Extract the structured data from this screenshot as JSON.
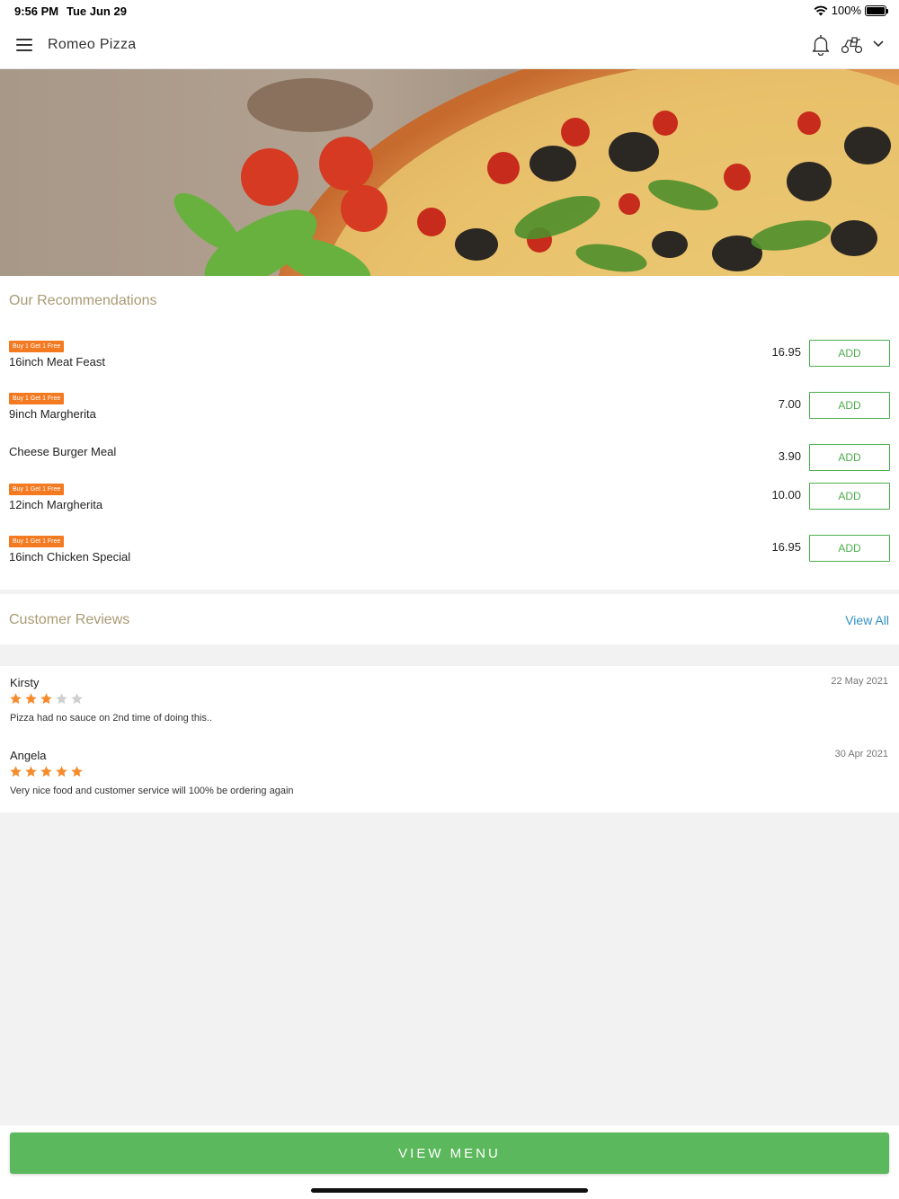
{
  "status": {
    "time": "9:56 PM",
    "date": "Tue Jun 29",
    "battery": "100%"
  },
  "nav": {
    "title": "Romeo Pizza",
    "icons": [
      "menu-icon",
      "bell-icon",
      "scooter-icon",
      "chevron-down-icon"
    ]
  },
  "recommendations": {
    "title": "Our Recommendations",
    "items": [
      {
        "badge": "Buy 1 Get 1 Free",
        "name": "16inch Meat Feast",
        "price": "16.95",
        "add": "ADD"
      },
      {
        "badge": "Buy 1 Get 1 Free",
        "name": "9inch Margherita",
        "price": "7.00",
        "add": "ADD"
      },
      {
        "badge": "",
        "name": "Cheese Burger Meal",
        "price": "3.90",
        "add": "ADD"
      },
      {
        "badge": "Buy 1 Get 1 Free",
        "name": "12inch Margherita",
        "price": "10.00",
        "add": "ADD"
      },
      {
        "badge": "Buy 1 Get 1 Free",
        "name": "16inch Chicken Special",
        "price": "16.95",
        "add": "ADD"
      }
    ]
  },
  "reviews": {
    "title": "Customer Reviews",
    "view_all": "View All",
    "items": [
      {
        "name": "Kirsty",
        "date": "22 May 2021",
        "rating": 3,
        "text": "Pizza had no sauce on 2nd time of doing this.."
      },
      {
        "name": "Angela",
        "date": "30 Apr 2021",
        "rating": 5,
        "text": "Very nice food and customer service will 100% be ordering again"
      }
    ]
  },
  "footer": {
    "button": "VIEW MENU"
  },
  "colors": {
    "accent_green": "#5cb85c",
    "badge_orange": "#f47a22",
    "section_title": "#a89a73",
    "link_blue": "#2f8fc6",
    "star": "#f58b2b"
  }
}
